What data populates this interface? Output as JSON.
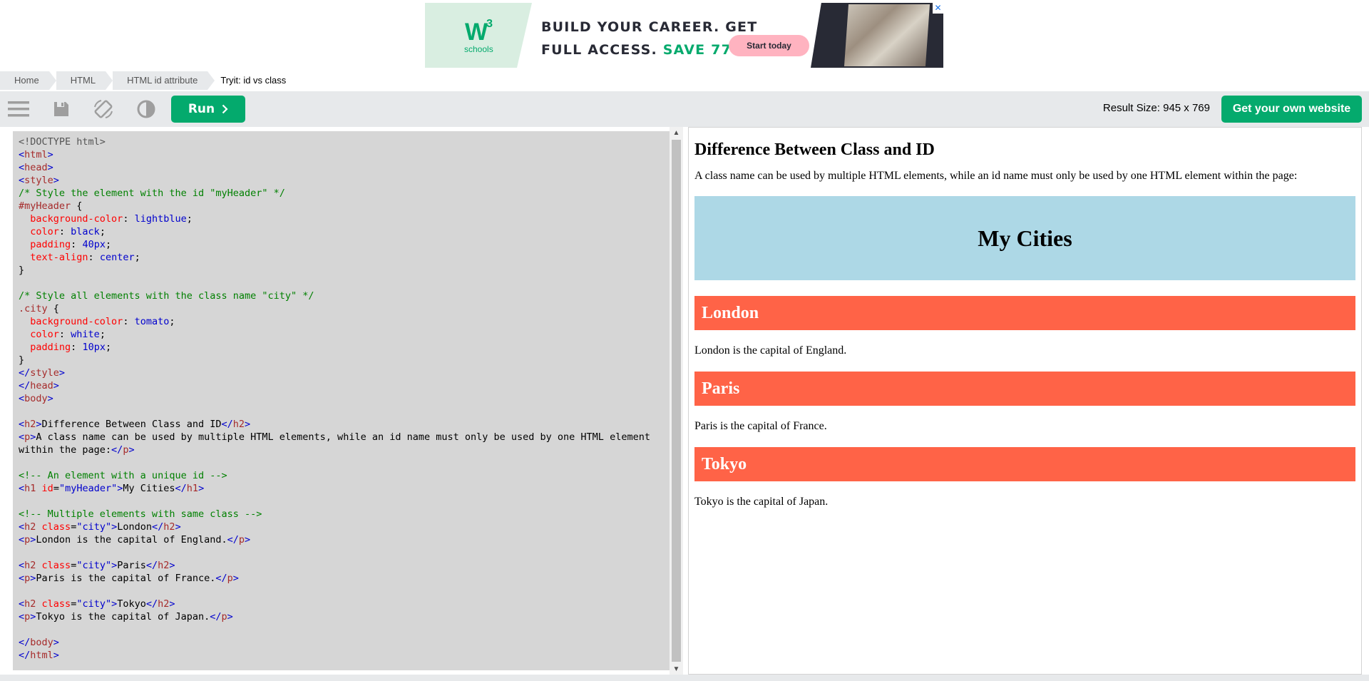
{
  "ad": {
    "logo_mark": "W",
    "logo_sup": "3",
    "logo_text": "schools",
    "headline_line1": "BUILD YOUR CAREER. GET",
    "headline_line2_prefix": "FULL ACCESS. ",
    "headline_save": "SAVE 770$",
    "cta_label": "Start today",
    "close_label": "✕",
    "accent_color": "#04aa6d"
  },
  "breadcrumb": {
    "items": [
      "Home",
      "HTML",
      "HTML id attribute"
    ],
    "current": "Tryit: id vs class"
  },
  "toolbar": {
    "run_label": "Run",
    "result_size": "Result Size: 945 x 769",
    "get_website_label": "Get your own website",
    "icons": [
      "menu-icon",
      "save-icon",
      "rotate-icon",
      "contrast-icon"
    ]
  },
  "code": {
    "lines": [
      "<!DOCTYPE html>",
      "<html>",
      "<head>",
      "<style>",
      "/* Style the element with the id \"myHeader\" */",
      "#myHeader {",
      "  background-color: lightblue;",
      "  color: black;",
      "  padding: 40px;",
      "  text-align: center;",
      "}",
      "",
      "/* Style all elements with the class name \"city\" */",
      ".city {",
      "  background-color: tomato;",
      "  color: white;",
      "  padding: 10px;",
      "}",
      "</style>",
      "</head>",
      "<body>",
      "",
      "<h2>Difference Between Class and ID</h2>",
      "<p>A class name can be used by multiple HTML elements, while an id name must only be used by one HTML element",
      "within the page:</p>",
      "",
      "<!-- An element with a unique id -->",
      "<h1 id=\"myHeader\">My Cities</h1>",
      "",
      "<!-- Multiple elements with same class -->",
      "<h2 class=\"city\">London</h2>",
      "<p>London is the capital of England.</p>",
      "",
      "<h2 class=\"city\">Paris</h2>",
      "<p>Paris is the capital of France.</p>",
      "",
      "<h2 class=\"city\">Tokyo</h2>",
      "<p>Tokyo is the capital of Japan.</p>",
      "",
      "</body>",
      "</html>"
    ]
  },
  "result": {
    "title": "Difference Between Class and ID",
    "intro": "A class name can be used by multiple HTML elements, while an id name must only be used by one HTML element within the page:",
    "header": "My Cities",
    "cities": [
      {
        "name": "London",
        "text": "London is the capital of England."
      },
      {
        "name": "Paris",
        "text": "Paris is the capital of France."
      },
      {
        "name": "Tokyo",
        "text": "Tokyo is the capital of Japan."
      }
    ],
    "header_bg": "#add8e6",
    "city_bg": "#ff6347"
  }
}
